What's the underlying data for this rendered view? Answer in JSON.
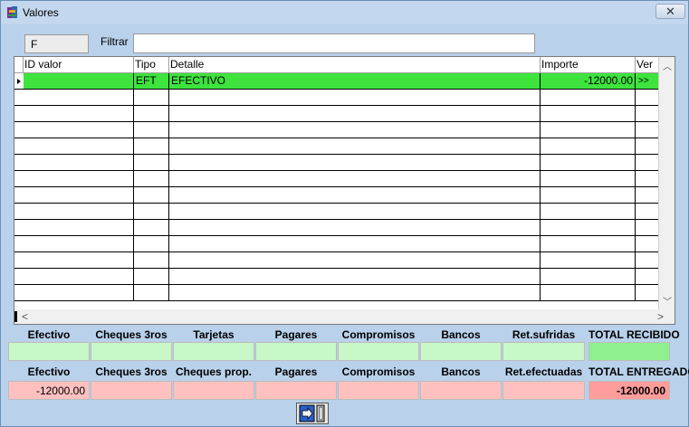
{
  "window": {
    "title": "Valores",
    "close_label": "✕"
  },
  "code_field": {
    "value": "F"
  },
  "filter": {
    "label": "Filtrar",
    "value": ""
  },
  "grid": {
    "columns": [
      "ID valor",
      "Tipo",
      "Detalle",
      "Importe",
      "Ver"
    ],
    "rows": [
      {
        "id": "",
        "tipo": "EFT",
        "detalle": "EFECTIVO",
        "importe": "-12000.00",
        "ver": ">>"
      }
    ],
    "empty_row_count": 13
  },
  "recibido": {
    "labels": [
      "Efectivo",
      "Cheques 3ros",
      "Tarjetas",
      "Pagares",
      "Compromisos",
      "Bancos",
      "Ret.sufridas",
      "TOTAL RECIBIDO"
    ],
    "values": [
      "",
      "",
      "",
      "",
      "",
      "",
      "",
      ""
    ]
  },
  "entregado": {
    "labels": [
      "Efectivo",
      "Cheques 3ros",
      "Cheques prop.",
      "Pagares",
      "Compromisos",
      "Bancos",
      "Ret.efectuadas",
      "TOTAL ENTREGADO"
    ],
    "values": [
      "-12000.00",
      "",
      "",
      "",
      "",
      "",
      "",
      "-12000.00"
    ]
  },
  "colors": {
    "selected_row": "#3ee33e",
    "recibido_box": "#c8f7c8",
    "entregado_box": "#ffc0c0"
  }
}
